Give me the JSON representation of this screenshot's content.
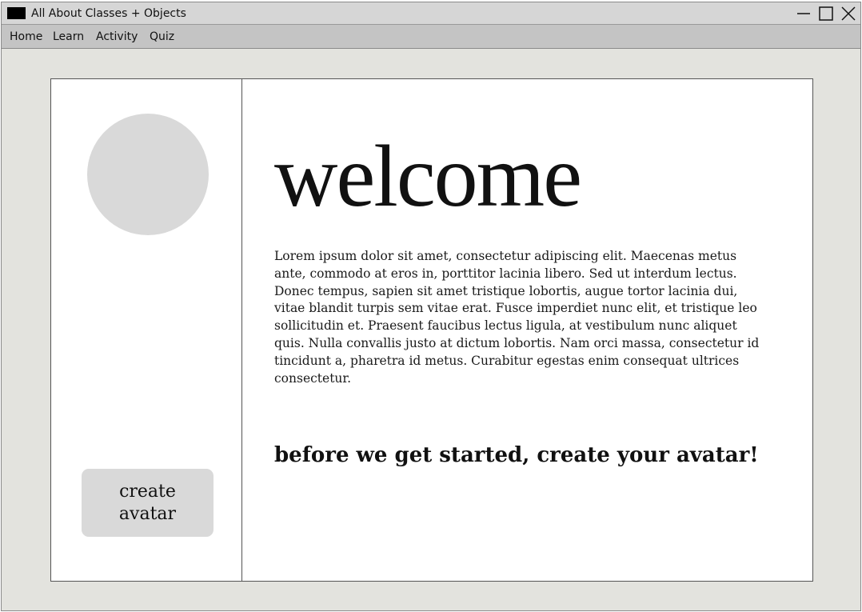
{
  "window": {
    "title": "All About Classes + Objects",
    "controls": {
      "minimize_icon": "minimize-icon",
      "maximize_icon": "maximize-icon",
      "close_icon": "close-icon"
    }
  },
  "menu": {
    "items": [
      {
        "label": "Home"
      },
      {
        "label": "Learn"
      },
      {
        "label": "Activity"
      },
      {
        "label": "Quiz"
      }
    ]
  },
  "sidebar": {
    "avatar_icon": "avatar-placeholder",
    "create_button_label": "create avatar"
  },
  "main": {
    "heading": "welcome",
    "body": "Lorem ipsum dolor sit amet, consectetur adipiscing elit. Maecenas metus ante, commodo at eros in, porttitor lacinia libero. Sed ut interdum lectus. Donec tempus, sapien sit amet tristique lobortis, augue tortor lacinia dui, vitae blandit turpis sem vitae erat. Fusce imperdiet nunc elit, et tristique leo sollicitudin et. Praesent faucibus lectus ligula, at vestibulum nunc aliquet quis. Nulla convallis justo at dictum lobortis. Nam orci massa, consectetur id tincidunt a, pharetra id metus. Curabitur egestas enim consequat ultrices consectetur.",
    "subheading": "before we get started, create your avatar!"
  },
  "colors": {
    "window_background": "#e3e3de",
    "titlebar": "#d6d6d6",
    "menubar": "#c4c4c4",
    "placeholder_gray": "#d9d9d9",
    "card": "#ffffff"
  }
}
